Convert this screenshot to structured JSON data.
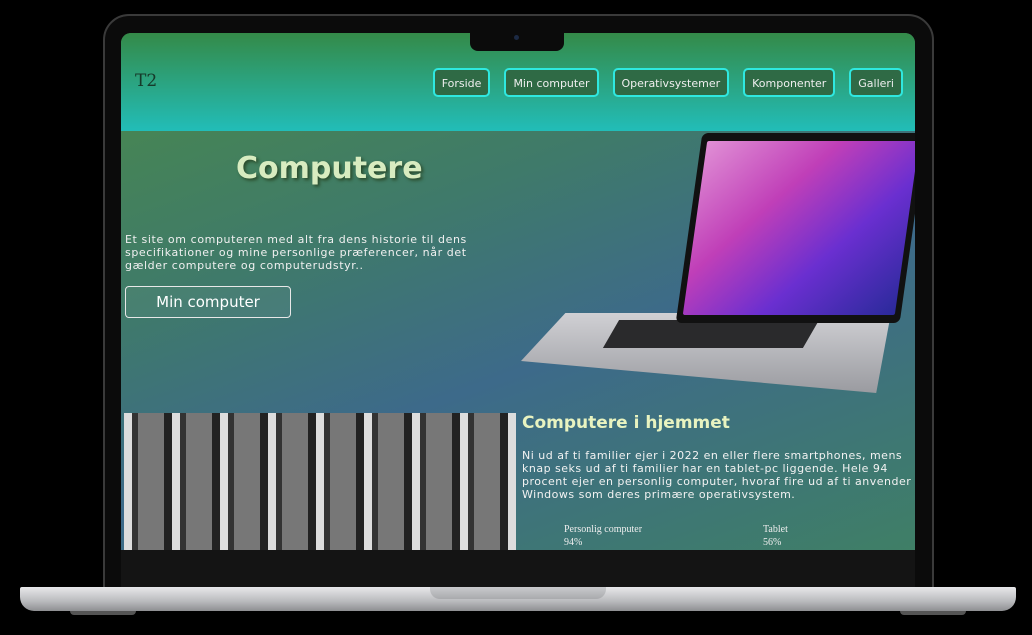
{
  "header": {
    "logo": "T2",
    "nav": [
      "Forside",
      "Min computer",
      "Operativsystemer",
      "Komponenter",
      "Galleri"
    ]
  },
  "hero": {
    "title": "Computere",
    "text": "Et site om computeren med alt fra dens historie til dens specifikationer og mine personlige præferencer, når det gælder computere og computerudstyr..",
    "button": "Min computer"
  },
  "section": {
    "title": "Computere i hjemmet",
    "text": "Ni ud af ti familier ejer i 2022 en eller flere smartphones, mens knap seks ud af ti familier har en tablet-pc liggende. Hele 94 procent ejer en personlig computer, hvoraf fire ud af ti anvender Windows som deres primære operativsystem.",
    "stats": [
      {
        "label": "Personlig computer",
        "value": "94%"
      },
      {
        "label": "Tablet",
        "value": "56%"
      }
    ]
  }
}
